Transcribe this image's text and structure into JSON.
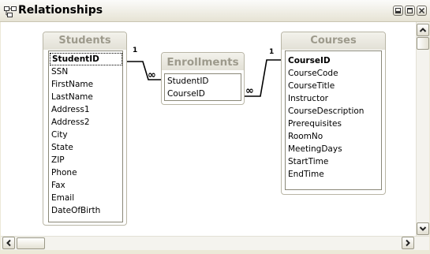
{
  "window": {
    "title": "Relationships"
  },
  "tables": {
    "students": {
      "title": "Students",
      "fields": [
        "StudentID",
        "SSN",
        "FirstName",
        "LastName",
        "Address1",
        "Address2",
        "City",
        "State",
        "ZIP",
        "Phone",
        "Fax",
        "Email",
        "DateOfBirth"
      ]
    },
    "enrollments": {
      "title": "Enrollments",
      "fields": [
        "StudentID",
        "CourseID"
      ]
    },
    "courses": {
      "title": "Courses",
      "fields": [
        "CourseID",
        "CourseCode",
        "CourseTitle",
        "Instructor",
        "CourseDescription",
        "Prerequisites",
        "RoomNo",
        "MeetingDays",
        "StartTime",
        "EndTime"
      ]
    }
  },
  "relationships": [
    {
      "one_label": "1",
      "many_label": "∞",
      "from": "Students.StudentID",
      "to": "Enrollments.StudentID"
    },
    {
      "one_label": "1",
      "many_label": "∞",
      "from": "Courses.CourseID",
      "to": "Enrollments.CourseID"
    }
  ],
  "icons": {
    "title": "relationships-icon",
    "minimize": "minimize-icon",
    "restore": "restore-icon",
    "close": "close-icon",
    "scroll_up": "arrow-up-icon",
    "scroll_down": "arrow-down-icon",
    "scroll_left": "arrow-left-icon",
    "scroll_right": "arrow-right-icon"
  }
}
